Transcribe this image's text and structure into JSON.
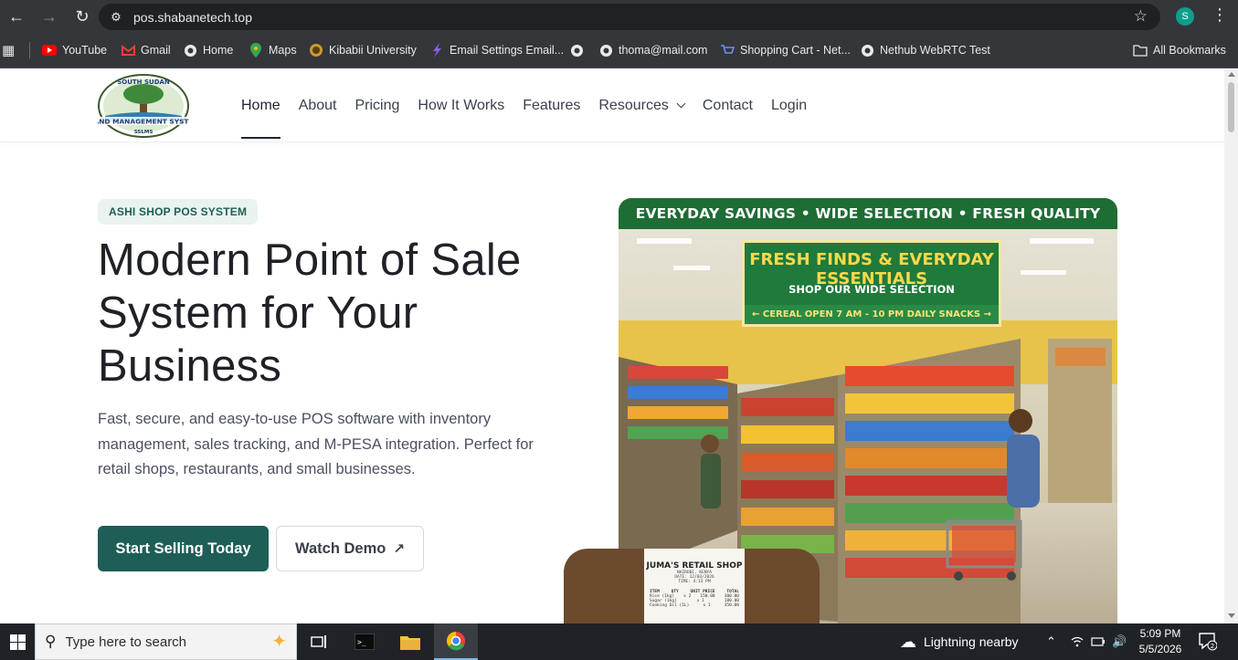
{
  "browser": {
    "url": "pos.shabanetech.top",
    "avatar_letter": "S",
    "bookmarks": [
      {
        "label": "YouTube",
        "icon": "youtube-icon"
      },
      {
        "label": "Gmail",
        "icon": "gmail-icon"
      },
      {
        "label": "Home",
        "icon": "globe-icon"
      },
      {
        "label": "Maps",
        "icon": "maps-icon"
      },
      {
        "label": "Kibabii University",
        "icon": "university-icon"
      },
      {
        "label": "Email Settings Email...",
        "icon": "email-settings-icon"
      },
      {
        "label": "",
        "icon": "globe-icon"
      },
      {
        "label": "thoma@mail.com",
        "icon": "globe-icon"
      },
      {
        "label": "Shopping Cart - Net...",
        "icon": "cart-icon"
      },
      {
        "label": "Nethub WebRTC Test",
        "icon": "globe-icon"
      }
    ],
    "all_bookmarks": "All Bookmarks"
  },
  "site": {
    "logo_alt": "South Sudan Land Management System SSLMS",
    "logo_text_top": "SOUTH SUDAN",
    "logo_text_mid": "AND MANAGEMENT SYSTE",
    "logo_text_bot": "SSLMS",
    "menu": {
      "home": "Home",
      "about": "About",
      "pricing": "Pricing",
      "how": "How It Works",
      "features": "Features",
      "resources": "Resources",
      "contact": "Contact",
      "login": "Login"
    },
    "pill": "ASHI SHOP POS SYSTEM",
    "hero_title": "Modern Point of Sale System for Your Business",
    "hero_desc": "Fast, secure, and easy-to-use POS software with inventory management, sales tracking, and M-PESA integration. Perfect for retail shops, restaurants, and small businesses.",
    "cta_primary": "Start Selling Today",
    "cta_secondary": "Watch Demo",
    "image": {
      "banner": "EVERYDAY SAVINGS • WIDE SELECTION • FRESH QUALITY",
      "sign_title": "FRESH FINDS & EVERYDAY ESSENTIALS",
      "sign_sub": "SHOP OUR WIDE SELECTION",
      "sign_left": "← CEREAL",
      "sign_mid": "OPEN 7 AM - 10 PM DAILY",
      "sign_right": "SNACKS →"
    },
    "receipt": {
      "title": "JUMA'S RETAIL SHOP",
      "loc": "NAIROBI, KENYA",
      "date": "DATE: 12/03/2026",
      "time": "TIME: 4:13 PM",
      "head": [
        "ITEM",
        "QTY",
        "UNIT PRICE",
        "TOTAL"
      ],
      "rows": [
        [
          "Rice (1kg)",
          "x 2",
          "150.00",
          "300.00"
        ],
        [
          "Sugar (1kg)",
          "x 1",
          "",
          "180.00"
        ],
        [
          "Cooking Oil (1L)",
          "x 1",
          "",
          "350.00"
        ]
      ]
    }
  },
  "taskbar": {
    "search_placeholder": "Type here to search",
    "weather": "Lightning nearby",
    "time": "5:09 PM",
    "date": "5/5/2026",
    "notif_count": "2"
  },
  "colors": {
    "brand": "#1d5e57",
    "pill_bg": "#e9f3ef",
    "banner": "#1e6d35"
  }
}
